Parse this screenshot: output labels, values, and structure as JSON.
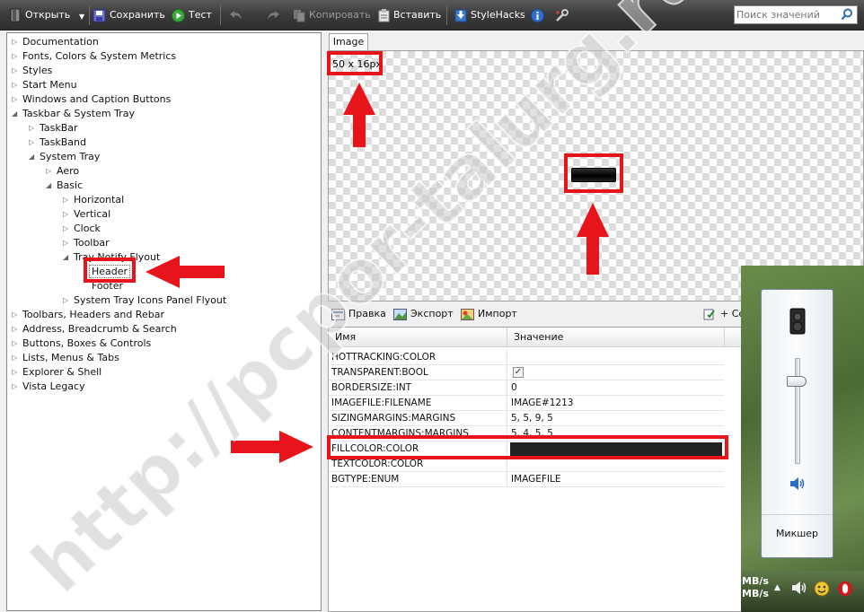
{
  "toolbar": {
    "open_label": "Открыть",
    "save_label": "Сохранить",
    "test_label": "Тест",
    "copy_label": "Копировать",
    "paste_label": "Вставить",
    "stylehacks_label": "StyleHacks",
    "search_placeholder": "Поиск значений"
  },
  "tree": {
    "items": [
      {
        "label": "Documentation"
      },
      {
        "label": "Fonts, Colors & System Metrics"
      },
      {
        "label": "Styles"
      },
      {
        "label": "Start Menu"
      },
      {
        "label": "Windows and Caption Buttons"
      },
      {
        "label": "Taskbar & System Tray"
      },
      {
        "label": "TaskBar"
      },
      {
        "label": "TaskBand"
      },
      {
        "label": "System Tray"
      },
      {
        "label": "Aero"
      },
      {
        "label": "Basic"
      },
      {
        "label": "Horizontal"
      },
      {
        "label": "Vertical"
      },
      {
        "label": "Clock"
      },
      {
        "label": "Toolbar"
      },
      {
        "label": "Tray Notify Flyout"
      },
      {
        "label": "Header"
      },
      {
        "label": "Footer"
      },
      {
        "label": "System Tray Icons Panel Flyout"
      },
      {
        "label": "Toolbars, Headers and Rebar"
      },
      {
        "label": "Address, Breadcrumb & Search"
      },
      {
        "label": "Buttons, Boxes & Controls"
      },
      {
        "label": "Lists, Menus & Tabs"
      },
      {
        "label": "Explorer & Shell"
      },
      {
        "label": "Vista Legacy"
      }
    ]
  },
  "preview": {
    "tab_label": "Image",
    "size_label": "50 x 16px"
  },
  "props_toolbar": {
    "edit_label": "Правка",
    "export_label": "Экспорт",
    "import_label": "Импорт",
    "new_label": "+ Се"
  },
  "props": {
    "col_name": "Имя",
    "col_value": "Значение",
    "rows": [
      {
        "name": "HOTTRACKING:COLOR",
        "value": ""
      },
      {
        "name": "TRANSPARENT:BOOL",
        "value": ""
      },
      {
        "name": "BORDERSIZE:INT",
        "value": "0"
      },
      {
        "name": "IMAGEFILE:FILENAME",
        "value": "IMAGE#1213"
      },
      {
        "name": "SIZINGMARGINS:MARGINS",
        "value": "5, 5, 9, 5"
      },
      {
        "name": "CONTENTMARGINS:MARGINS",
        "value": "5, 4, 5, 5"
      },
      {
        "name": "FILLCOLOR:COLOR",
        "value": ""
      },
      {
        "name": "TEXTCOLOR:COLOR",
        "value": ""
      },
      {
        "name": "BGTYPE:ENUM",
        "value": "IMAGEFILE"
      }
    ],
    "transparent_checked": true,
    "fill_color": "#222222"
  },
  "volume": {
    "level": 0.78,
    "mixer_label": "Микшер"
  },
  "taskbar": {
    "net_line_1": "MB/s",
    "net_line_2": "MB/s"
  },
  "watermark": "http://pcpor-talurg.ru",
  "colors": {
    "annotation_red": "#e8141b",
    "toolbar_dark": "#3b3b3b"
  }
}
